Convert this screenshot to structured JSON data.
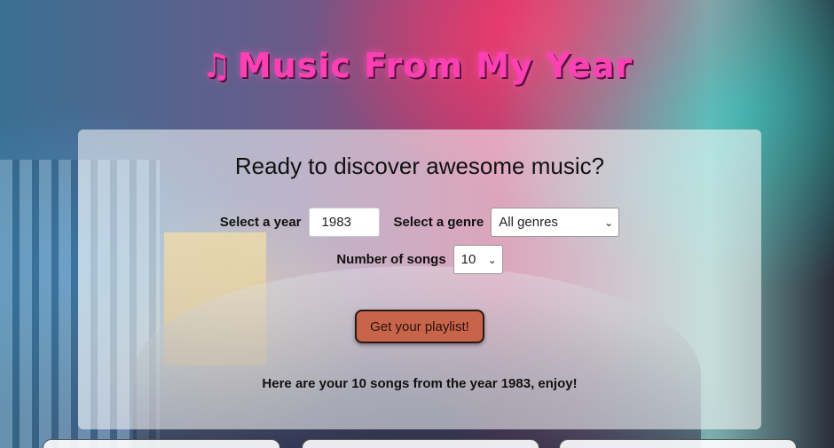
{
  "app": {
    "title": "Music From My Year",
    "title_icon": "music-note-icon"
  },
  "form": {
    "heading": "Ready to discover awesome music?",
    "year_label": "Select a year",
    "year_value": "1983",
    "genre_label": "Select a genre",
    "genre_selected": "All genres",
    "songs_label": "Number of songs",
    "songs_selected": "10",
    "submit_label": "Get your playlist!"
  },
  "result": {
    "message": "Here are your 10 songs from the year 1983, enjoy!"
  },
  "colors": {
    "title": "#ff3fb4",
    "button": "#c8644a"
  }
}
